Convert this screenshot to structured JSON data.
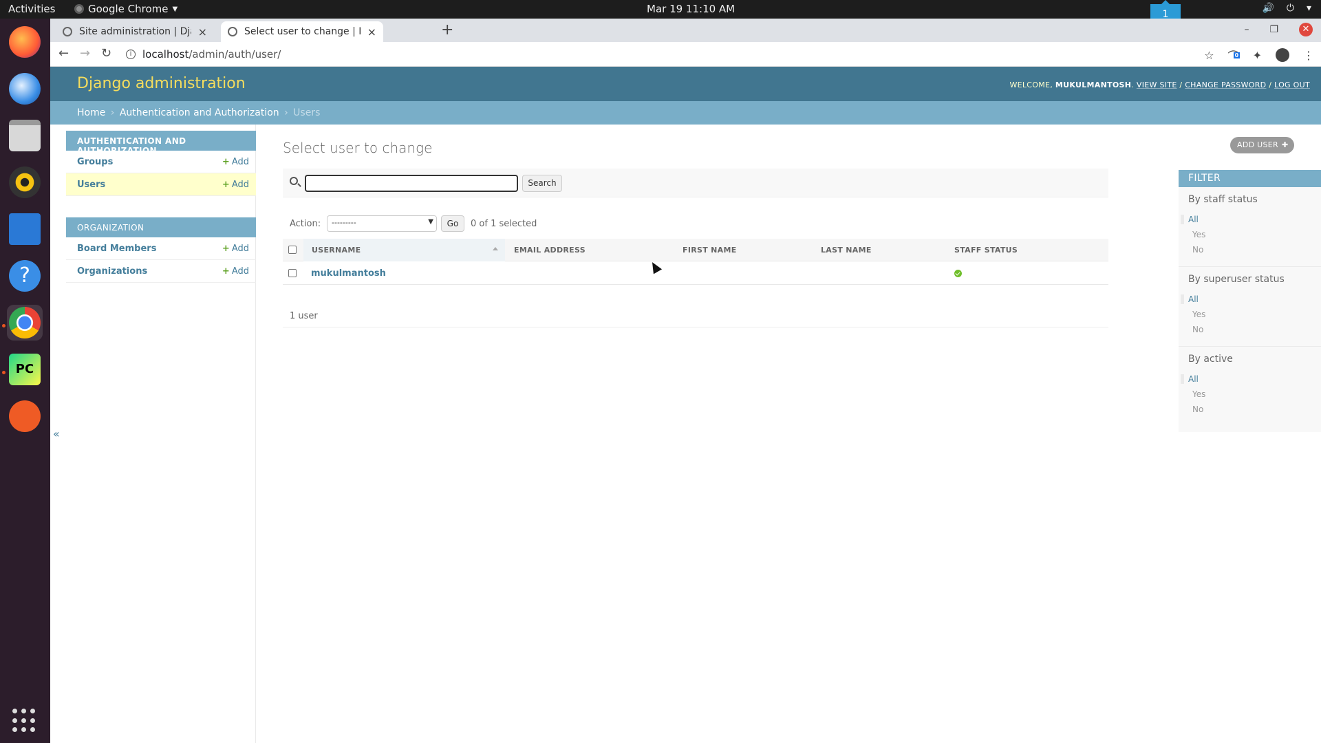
{
  "topbar": {
    "activities": "Activities",
    "app_name": "Google Chrome",
    "clock": "Mar 19  11:10 AM",
    "workspace_badge": "1"
  },
  "browser": {
    "tabs": [
      {
        "title": "Site administration | Django site admin",
        "active": false
      },
      {
        "title": "Select user to change | Django site admin",
        "active": true
      }
    ],
    "url_host": "localhost",
    "url_path": "/admin/auth/user/",
    "extension_badge": "0"
  },
  "admin": {
    "site_name": "Django administration",
    "user_tools": {
      "welcome": "WELCOME,",
      "username": "MUKULMANTOSH",
      "view_site": "VIEW SITE",
      "change_password": "CHANGE PASSWORD",
      "log_out": "LOG OUT",
      "separator": "/"
    },
    "breadcrumbs": {
      "home": "Home",
      "app": "Authentication and Authorization",
      "current": "Users",
      "sep": "›"
    },
    "sidebar": {
      "modules": [
        {
          "caption": "AUTHENTICATION AND AUTHORIZATION",
          "models": [
            {
              "name": "Groups",
              "add": "Add",
              "current": false
            },
            {
              "name": "Users",
              "add": "Add",
              "current": true
            }
          ]
        },
        {
          "caption": "ORGANIZATION",
          "models": [
            {
              "name": "Board Members",
              "add": "Add",
              "current": false
            },
            {
              "name": "Organizations",
              "add": "Add",
              "current": false
            }
          ]
        }
      ],
      "collapse": "«"
    },
    "page_title": "Select user to change",
    "add_button": "ADD USER",
    "search": {
      "value": "",
      "button": "Search"
    },
    "actions": {
      "label": "Action:",
      "selected_option": "---------",
      "go": "Go",
      "counter": "0 of 1 selected"
    },
    "table": {
      "columns": [
        "USERNAME",
        "EMAIL ADDRESS",
        "FIRST NAME",
        "LAST NAME",
        "STAFF STATUS"
      ],
      "rows": [
        {
          "username": "mukulmantosh",
          "email": "",
          "first_name": "",
          "last_name": "",
          "staff_status": true
        }
      ]
    },
    "paginator": "1 user",
    "filter": {
      "heading": "FILTER",
      "groups": [
        {
          "title": "By staff status",
          "options": [
            "All",
            "Yes",
            "No"
          ],
          "selected": 0
        },
        {
          "title": "By superuser status",
          "options": [
            "All",
            "Yes",
            "No"
          ],
          "selected": 0
        },
        {
          "title": "By active",
          "options": [
            "All",
            "Yes",
            "No"
          ],
          "selected": 0
        }
      ]
    }
  },
  "colors": {
    "header": "#417690",
    "breadcrumb": "#79aec8",
    "site_name": "#f5dd5d",
    "link": "#447e9b",
    "add_plus": "#5fa225",
    "current_model_bg": "#ffffcc"
  }
}
